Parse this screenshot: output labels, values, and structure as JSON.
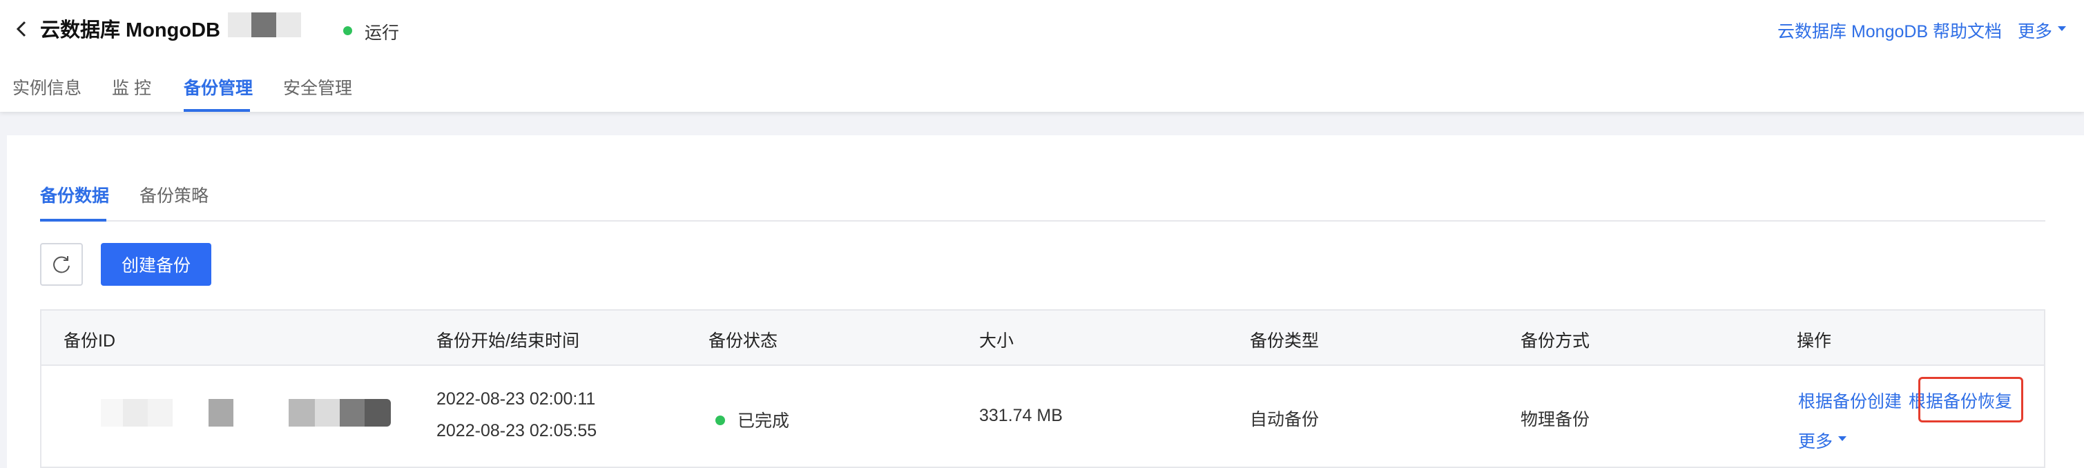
{
  "header": {
    "title": "云数据库 MongoDB",
    "status_label": "运行",
    "help_link": "云数据库 MongoDB 帮助文档",
    "more_label": "更多",
    "status_color": "#2fc25b",
    "accent_color": "#2e6ee6"
  },
  "tabs": [
    {
      "label": "实例信息"
    },
    {
      "label": "监 控"
    },
    {
      "label": "备份管理"
    },
    {
      "label": "安全管理"
    }
  ],
  "subtabs": [
    {
      "label": "备份数据"
    },
    {
      "label": "备份策略"
    }
  ],
  "toolbar": {
    "refresh_icon": "refresh-icon",
    "create_label": "创建备份"
  },
  "table": {
    "headers": [
      "备份ID",
      "备份开始/结束时间",
      "备份状态",
      "大小",
      "备份类型",
      "备份方式",
      "操作"
    ],
    "rows": [
      {
        "start_time": "2022-08-23 02:00:11",
        "end_time": "2022-08-23 02:05:55",
        "status": "已完成",
        "size": "331.74 MB",
        "type": "自动备份",
        "method": "物理备份",
        "actions": {
          "create_from_backup": "根据备份创建",
          "restore_from_backup": "根据备份恢复",
          "more": "更多"
        }
      }
    ]
  }
}
